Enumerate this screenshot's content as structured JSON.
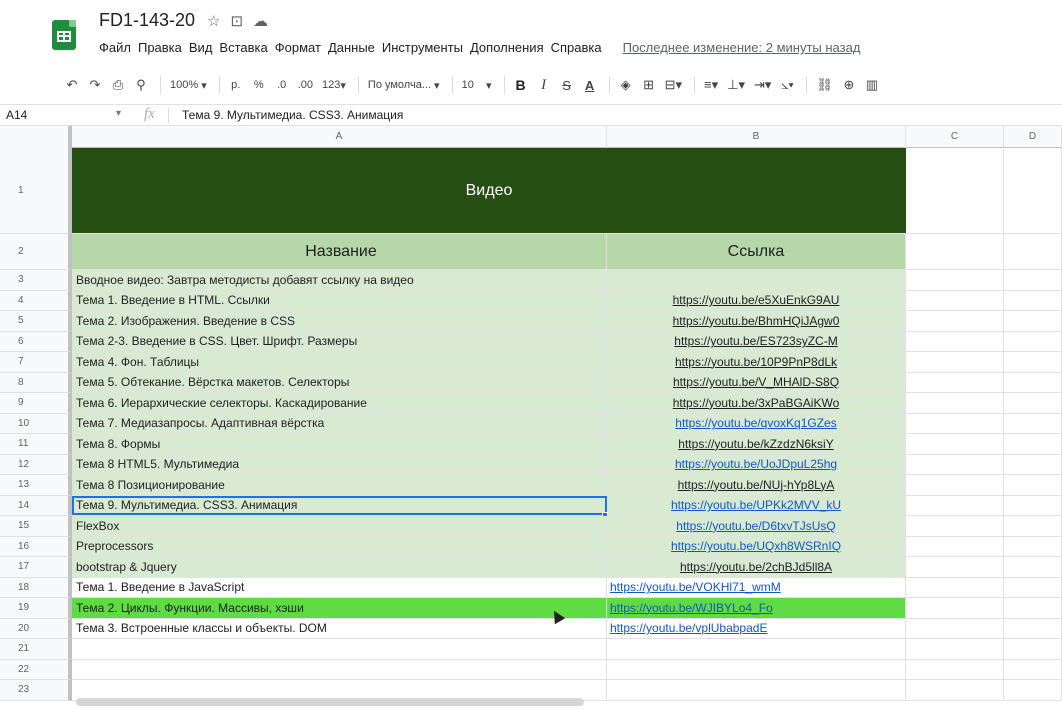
{
  "app": {
    "title": "FD1-143-20",
    "menus": [
      "Файл",
      "Правка",
      "Вид",
      "Вставка",
      "Формат",
      "Данные",
      "Инструменты",
      "Дополнения",
      "Справка"
    ],
    "last_edit": "Последнее изменение: 2 минуты назад"
  },
  "toolbar": {
    "zoom": "100%",
    "currency": "р.",
    "percent": "%",
    "dec_less": ".0",
    "dec_more": ".00",
    "format": "123",
    "font": "По умолча...",
    "font_size": "10",
    "bold": "B",
    "italic": "I",
    "strike": "S",
    "text_color": "A"
  },
  "formula_bar": {
    "cell_ref": "A14",
    "fx": "fx",
    "content": "Тема 9. Мультимедиа. CSS3. Анимация"
  },
  "columns": [
    "A",
    "B",
    "C",
    "D"
  ],
  "rows": [
    {
      "n": "1",
      "a": "Видео",
      "b": "",
      "style": "title"
    },
    {
      "n": "2",
      "a": "Название",
      "b": "Ссылка",
      "style": "head"
    },
    {
      "n": "3",
      "a": "Вводное видео: Завтра методисты добавят ссылку на видео",
      "b": "",
      "style": "green"
    },
    {
      "n": "4",
      "a": "Тема 1. Введение в HTML. Ссылки",
      "b": "https://youtu.be/e5XuEnkG9AU",
      "style": "green",
      "link": "dark"
    },
    {
      "n": "5",
      "a": "Тема 2. Изображения. Введение в CSS",
      "b": "https://youtu.be/BhmHQiJAgw0",
      "style": "green",
      "link": "dark"
    },
    {
      "n": "6",
      "a": "Тема 2-3. Введение в CSS. Цвет. Шрифт. Размеры",
      "b": "https://youtu.be/ES723syZC-M",
      "style": "green",
      "link": "dark"
    },
    {
      "n": "7",
      "a": "Тема 4. Фон. Таблицы",
      "b": "https://youtu.be/10P9PnP8dLk",
      "style": "green",
      "link": "dark"
    },
    {
      "n": "8",
      "a": "Тема 5. Обтекание. Вёрстка макетов. Селекторы",
      "b": "https://youtu.be/V_MHAlD-S8Q",
      "style": "green",
      "link": "dark"
    },
    {
      "n": "9",
      "a": "Тема 6. Иерархические селекторы. Каскадирование",
      "b": "https://youtu.be/3xPaBGAiKWo",
      "style": "green",
      "link": "dark"
    },
    {
      "n": "10",
      "a": "Тема 7. Медиазапросы. Адаптивная вёрстка",
      "b": "https://youtu.be/qvoxKq1GZes",
      "style": "green",
      "link": "blue"
    },
    {
      "n": "11",
      "a": "Тема 8. Формы",
      "b": "https://youtu.be/kZzdzN6ksiY",
      "style": "green",
      "link": "dark"
    },
    {
      "n": "12",
      "a": "Тема 8 HTML5. Мультимедиа",
      "b": "https://youtu.be/UoJDpuL25hg",
      "style": "green",
      "link": "blue"
    },
    {
      "n": "13",
      "a": "Тема 8 Позиционирование",
      "b": "https://youtu.be/NUj-hYp8LyA",
      "style": "green",
      "link": "dark"
    },
    {
      "n": "14",
      "a": "Тема 9. Мультимедиа. CSS3. Анимация",
      "b": "https://youtu.be/UPKk2MVV_kU",
      "style": "green",
      "link": "blue",
      "selected": true
    },
    {
      "n": "15",
      "a": "FlexBox",
      "b": "https://youtu.be/D6txvTJsUsQ",
      "style": "green",
      "link": "blue"
    },
    {
      "n": "16",
      "a": "Preprocessors",
      "b": "https://youtu.be/UQxh8WSRnIQ",
      "style": "green",
      "link": "blue"
    },
    {
      "n": "17",
      "a": "bootstrap & Jquery",
      "b": "https://youtu.be/2chBJd5ll8A",
      "style": "green",
      "link": "dark"
    },
    {
      "n": "18",
      "a": "Тема 1. Введение в JavaScript",
      "b": "https://youtu.be/VOKHl71_wmM",
      "style": "plain",
      "link": "blue-left"
    },
    {
      "n": "19",
      "a": "Тема 2. Циклы. Функции. Массивы, хэши",
      "b": "https://youtu.be/WJIBYLo4_Fo",
      "style": "bright",
      "link": "blue-left"
    },
    {
      "n": "20",
      "a": "Тема 3. Встроенные классы и объекты. DOM",
      "b": "https://youtu.be/vplUbabpadE",
      "style": "plain",
      "link": "blue-left"
    },
    {
      "n": "21",
      "a": "",
      "b": "",
      "style": "plain"
    },
    {
      "n": "22",
      "a": "",
      "b": "",
      "style": "plain"
    },
    {
      "n": "23",
      "a": "",
      "b": "",
      "style": "plain"
    }
  ],
  "colors": {
    "title_bg": "#274e13",
    "header_bg": "#b6d7a8",
    "row_bg": "#d9ead3",
    "highlight_bg": "#5fdc44",
    "selection": "#1a73e8"
  }
}
